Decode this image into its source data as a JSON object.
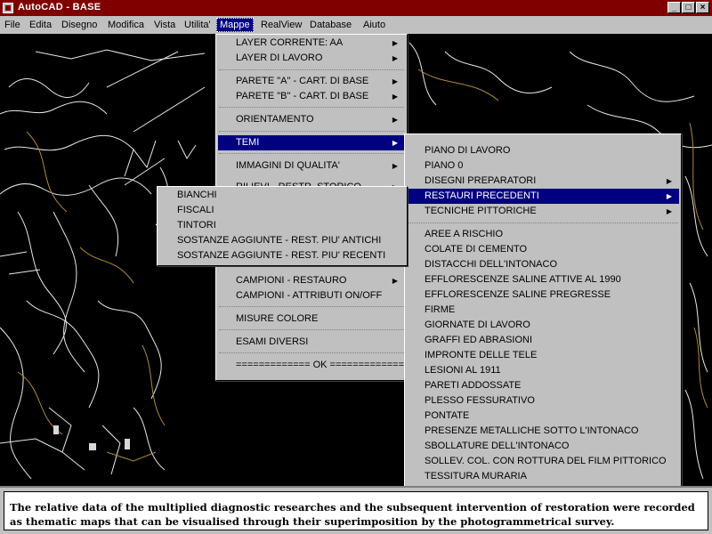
{
  "window": {
    "title": "AutoCAD - BASE",
    "buttons": [
      "_",
      "□",
      "×"
    ]
  },
  "menubar": {
    "items": [
      "File",
      "Edita",
      "Disegno",
      "Modifica",
      "Vista",
      "Utilita'",
      "Mappe",
      "RealView",
      "Database",
      "Aiuto"
    ],
    "active": "Mappe"
  },
  "menu_mappe": {
    "items": [
      {
        "label": "LAYER CORRENTE: AA",
        "submenu": true
      },
      {
        "label": "LAYER DI LAVORO",
        "submenu": true
      },
      {
        "label": "PARETE \"A\" - CART. DI BASE",
        "submenu": true
      },
      {
        "label": "PARETE \"B\" - CART. DI BASE",
        "submenu": true
      },
      {
        "label": "ORIENTAMENTO",
        "submenu": true
      },
      {
        "label": "TEMI",
        "submenu": true,
        "highlighted": true
      },
      {
        "label": "IMMAGINI DI QUALITA'",
        "submenu": true
      },
      {
        "label": "RILIEVI - RESTR. STORICO",
        "submenu": true
      },
      {
        "label": "CAMPIONI - RESTAURO",
        "submenu": true
      },
      {
        "label": "CAMPIONI - ATTRIBUTI ON/OFF",
        "submenu": false
      },
      {
        "label": "MISURE COLORE",
        "submenu": false
      },
      {
        "label": "ESAMI DIVERSI",
        "submenu": false
      },
      {
        "label": "============= OK =============",
        "submenu": false
      }
    ]
  },
  "menu_temi": {
    "top_items": [
      {
        "label": "PIANO DI LAVORO",
        "submenu": false
      },
      {
        "label": "PIANO 0",
        "submenu": false
      },
      {
        "label": "DISEGNI PREPARATORI",
        "submenu": true
      },
      {
        "label": "RESTAURI PRECEDENTI",
        "submenu": true,
        "highlighted": true
      },
      {
        "label": "TECNICHE PITTORICHE",
        "submenu": true
      }
    ],
    "items": [
      "AREE A RISCHIO",
      "COLATE DI CEMENTO",
      "DISTACCHI DELL'INTONACO",
      "EFFLORESCENZE SALINE ATTIVE AL 1990",
      "EFFLORESCENZE SALINE PREGRESSE",
      "FIRME",
      "GIORNATE DI LAVORO",
      "GRAFFI ED ABRASIONI",
      "IMPRONTE DELLE TELE",
      "LESIONI AL 1911",
      "PARETI ADDOSSATE",
      "PLESSO FESSURATIVO",
      "PONTATE",
      "PRESENZE METALLICHE SOTTO L'INTONACO",
      "SBOLLATURE DELL'INTONACO",
      "SOLLEV. COL. CON ROTTURA DEL FILM PITTORICO",
      "TESSITURA MURARIA"
    ]
  },
  "menu_restauri": {
    "items": [
      "BIANCHI",
      "FISCALI",
      "TINTORI",
      "SOSTANZE AGGIUNTE - REST. PIU' ANTICHI",
      "SOSTANZE AGGIUNTE - REST. PIU' RECENTI"
    ]
  },
  "status": {
    "text": "The relative data of the multiplied diagnostic researches and the subsequent intervention of restoration were recorded as thematic maps that can be visualised through their superimposition by the photogrammetrical survey."
  },
  "colors": {
    "titlebar": "#800000",
    "highlight": "#000080",
    "menu_bg": "#c0c0c0",
    "canvas_bg": "#000000"
  }
}
